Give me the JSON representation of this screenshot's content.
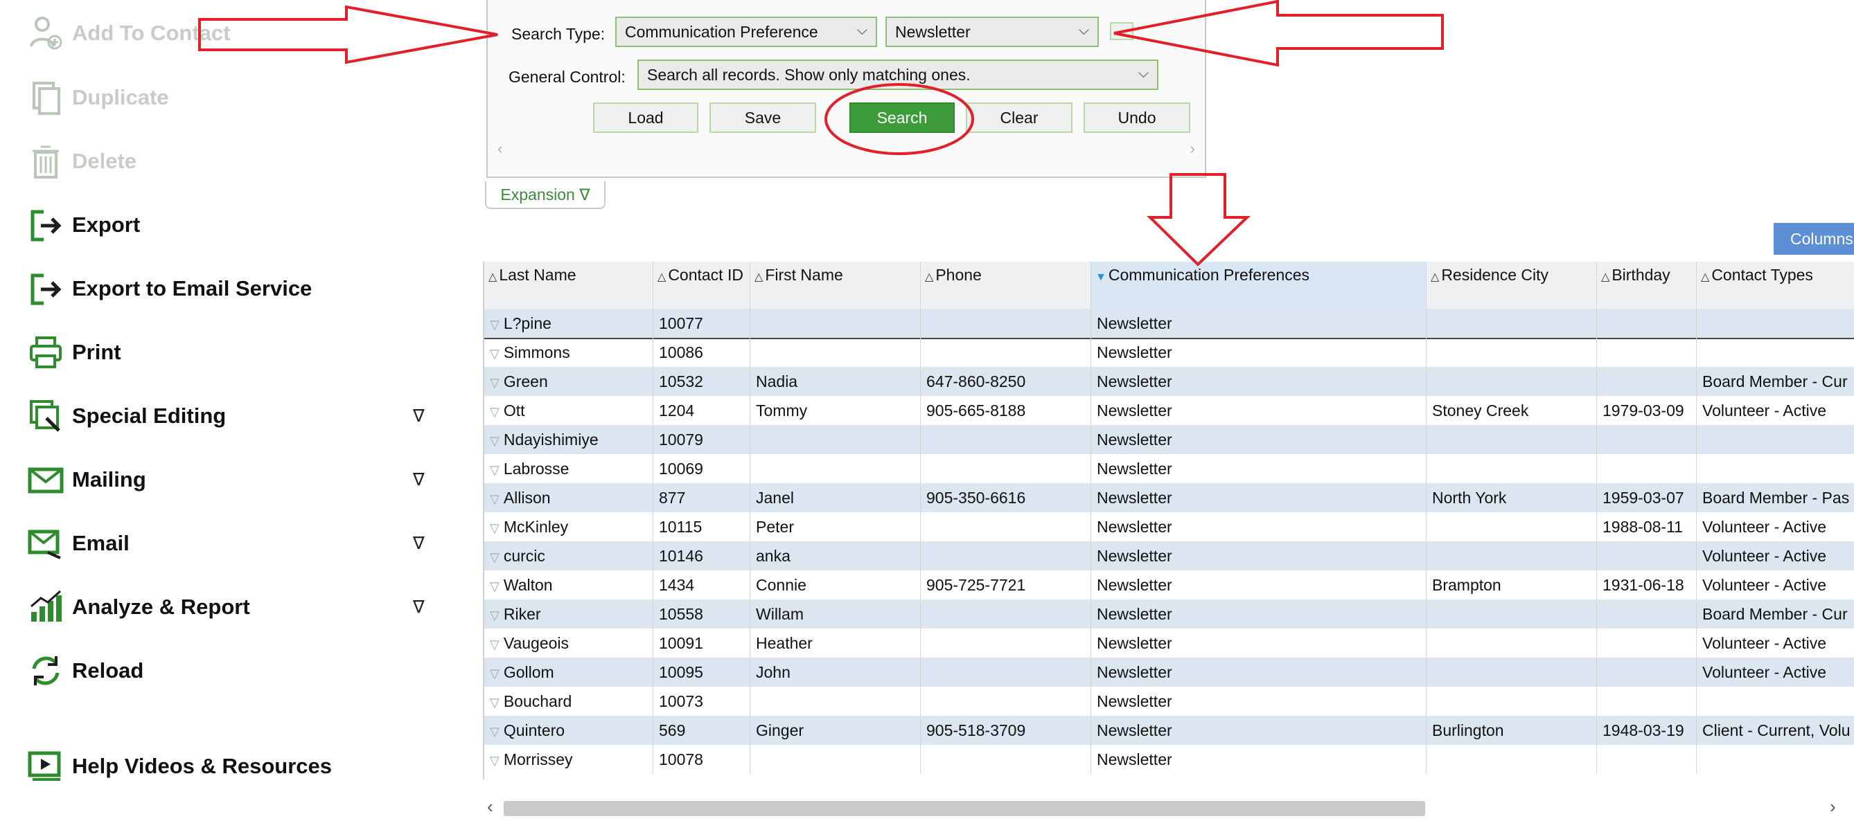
{
  "sidebar": {
    "items": [
      {
        "label": "Add To Contact",
        "icon": "person-add-icon",
        "disabled": true
      },
      {
        "label": "Duplicate",
        "icon": "duplicate-icon",
        "disabled": true
      },
      {
        "label": "Delete",
        "icon": "trash-icon",
        "disabled": true
      },
      {
        "label": "Export",
        "icon": "export-icon"
      },
      {
        "label": "Export to Email Service",
        "icon": "export-icon"
      },
      {
        "label": "Print",
        "icon": "printer-icon"
      },
      {
        "label": "Special Editing",
        "icon": "special-edit-icon",
        "expand": "∇"
      },
      {
        "label": "Mailing",
        "icon": "mail-icon",
        "expand": "∇"
      },
      {
        "label": "Email",
        "icon": "email-icon",
        "expand": "∇"
      },
      {
        "label": "Analyze & Report",
        "icon": "bar-chart-icon",
        "expand": "∇"
      },
      {
        "label": "Reload",
        "icon": "reload-icon"
      },
      {
        "label": "Help Videos & Resources",
        "icon": "video-icon"
      }
    ]
  },
  "search": {
    "type_label": "Search Type:",
    "type_value": "Communication Preference",
    "value_value": "Newsletter",
    "control_label": "General Control:",
    "control_value": "Search all records. Show only matching ones.",
    "buttons": {
      "load": "Load",
      "save": "Save",
      "search": "Search",
      "clear": "Clear",
      "undo": "Undo"
    }
  },
  "expansion_label": "Expansion ∇",
  "columns_label": "Columns",
  "grid": {
    "columns": [
      "Last Name",
      "Contact ID",
      "First Name",
      "Phone",
      "Communication Preferences",
      "Residence City",
      "Birthday",
      "Contact Types"
    ],
    "rows": [
      [
        "L?pine",
        "10077",
        "",
        "",
        "Newsletter",
        "",
        "",
        ""
      ],
      [
        "Simmons",
        "10086",
        "",
        "",
        "Newsletter",
        "",
        "",
        ""
      ],
      [
        "Green",
        "10532",
        "Nadia",
        "647-860-8250",
        "Newsletter",
        "",
        "",
        "Board Member - Cur"
      ],
      [
        "Ott",
        "1204",
        "Tommy",
        "905-665-8188",
        "Newsletter",
        "Stoney Creek",
        "1979-03-09",
        "Volunteer - Active"
      ],
      [
        "Ndayishimiye",
        "10079",
        "",
        "",
        "Newsletter",
        "",
        "",
        ""
      ],
      [
        "Labrosse",
        "10069",
        "",
        "",
        "Newsletter",
        "",
        "",
        ""
      ],
      [
        "Allison",
        "877",
        "Janel",
        "905-350-6616",
        "Newsletter",
        "North York",
        "1959-03-07",
        "Board Member - Pas"
      ],
      [
        "McKinley",
        "10115",
        "Peter",
        "",
        "Newsletter",
        "",
        "1988-08-11",
        "Volunteer - Active"
      ],
      [
        "curcic",
        "10146",
        "anka",
        "",
        "Newsletter",
        "",
        "",
        "Volunteer - Active"
      ],
      [
        "Walton",
        "1434",
        "Connie",
        "905-725-7721",
        "Newsletter",
        "Brampton",
        "1931-06-18",
        "Volunteer - Active"
      ],
      [
        "Riker",
        "10558",
        "Willam",
        "",
        "Newsletter",
        "",
        "",
        "Board Member - Cur"
      ],
      [
        "Vaugeois",
        "10091",
        "Heather",
        "",
        "Newsletter",
        "",
        "",
        "Volunteer - Active"
      ],
      [
        "Gollom",
        "10095",
        "John",
        "",
        "Newsletter",
        "",
        "",
        "Volunteer - Active"
      ],
      [
        "Bouchard",
        "10073",
        "",
        "",
        "Newsletter",
        "",
        "",
        ""
      ],
      [
        "Quintero",
        "569",
        "Ginger",
        "905-518-3709",
        "Newsletter",
        "Burlington",
        "1948-03-19",
        "Client - Current, Volu"
      ],
      [
        "Morrissey",
        "10078",
        "",
        "",
        "Newsletter",
        "",
        "",
        ""
      ]
    ]
  },
  "colors": {
    "accent_green": "#3d9b3a",
    "annotation_red": "#e0202a",
    "row_alt": "#dce6f1",
    "columns_blue": "#5e8fd6"
  }
}
